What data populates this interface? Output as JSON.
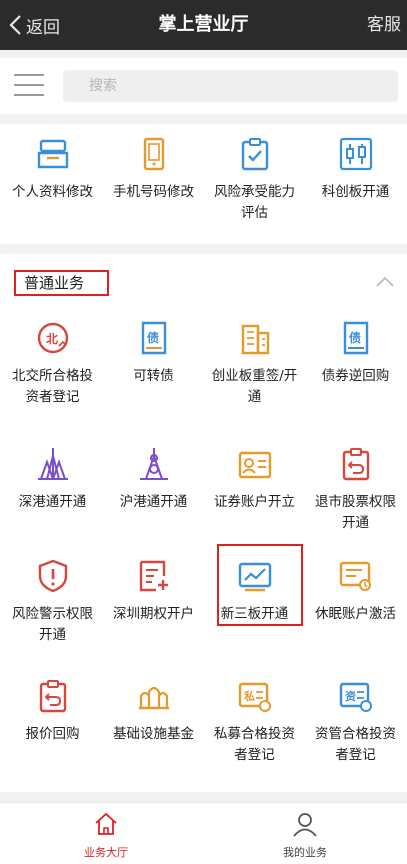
{
  "header": {
    "back_label": "返回",
    "title": "掌上营业厅",
    "service_label": "客服"
  },
  "search": {
    "placeholder": "搜索"
  },
  "quick_actions": [
    {
      "label": "个人资料修改",
      "icon": "profile-tray-icon"
    },
    {
      "label": "手机号码修改",
      "icon": "mobile-phone-icon"
    },
    {
      "label": "风险承受能力评估",
      "icon": "clipboard-check-icon"
    },
    {
      "label": "科创板开通",
      "icon": "candlestick-chart-icon"
    }
  ],
  "section": {
    "title": "普通业务",
    "toggle_icon": "chevron-up-icon"
  },
  "services": [
    {
      "label": "北交所合格投资者登记",
      "icon": "beijing-exchange-icon"
    },
    {
      "label": "可转债",
      "icon": "bond-document-icon"
    },
    {
      "label": "创业板重签/开通",
      "icon": "building-icon"
    },
    {
      "label": "债券逆回购",
      "icon": "bond-document-icon"
    },
    {
      "label": "深港通开通",
      "icon": "shenzhen-tower-icon"
    },
    {
      "label": "沪港通开通",
      "icon": "shanghai-tower-icon"
    },
    {
      "label": "证券账户开立",
      "icon": "id-card-icon"
    },
    {
      "label": "退市股票权限开通",
      "icon": "return-clipboard-icon"
    },
    {
      "label": "风险警示权限开通",
      "icon": "warning-shield-icon"
    },
    {
      "label": "深圳期权开户",
      "icon": "options-document-icon"
    },
    {
      "label": "新三板开通",
      "icon": "trend-chart-icon"
    },
    {
      "label": "休眠账户激活",
      "icon": "dormant-account-icon"
    },
    {
      "label": "报价回购",
      "icon": "quote-repo-icon"
    },
    {
      "label": "基础设施基金",
      "icon": "infrastructure-fund-icon"
    },
    {
      "label": "私募合格投资者登记",
      "icon": "private-fund-icon"
    },
    {
      "label": "资管合格投资者登记",
      "icon": "asset-management-icon"
    }
  ],
  "tabs": [
    {
      "label": "业务大厅",
      "active": true,
      "icon": "home-icon"
    },
    {
      "label": "我的业务",
      "active": false,
      "icon": "user-icon"
    }
  ],
  "colors": {
    "blue": "#3a8fd9",
    "orange": "#e59a2c",
    "red": "#d9463b",
    "purple": "#7a4fc9",
    "active_tab": "#e02020",
    "highlight": "#e02020"
  }
}
